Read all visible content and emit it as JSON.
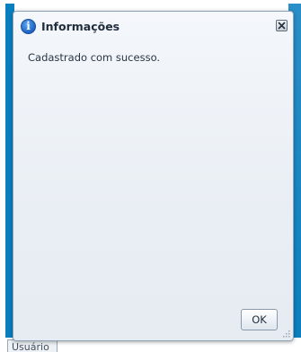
{
  "dialog": {
    "title": "Informações",
    "message": "Cadastrado com sucesso.",
    "ok_label": "OK",
    "info_icon_glyph": "i",
    "close_icon": "close-icon",
    "header_icon": "info-icon"
  },
  "background": {
    "tab_label": "Usuário",
    "accent_color": "#0a7fbf"
  }
}
